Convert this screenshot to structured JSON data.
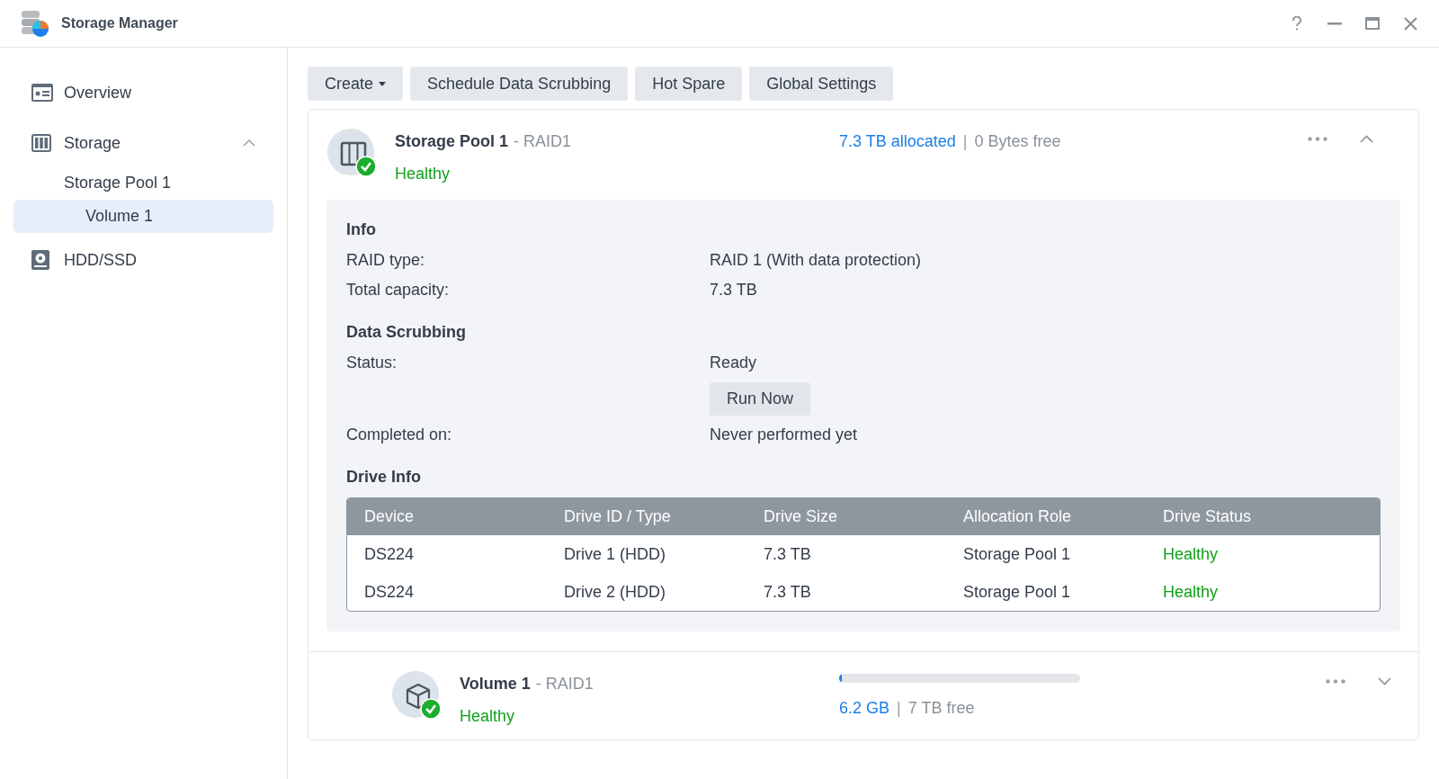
{
  "window": {
    "title": "Storage Manager"
  },
  "sidebar": {
    "items": [
      {
        "kind": "overview",
        "label": "Overview",
        "selected": false
      },
      {
        "kind": "storage",
        "label": "Storage",
        "selected": false,
        "expanded": true,
        "children": [
          {
            "label": "Storage Pool 1",
            "selected": false,
            "children": [
              {
                "label": "Volume 1",
                "selected": true
              }
            ]
          }
        ]
      },
      {
        "kind": "hdd",
        "label": "HDD/SSD",
        "selected": false
      }
    ]
  },
  "toolbar": [
    {
      "label": "Create",
      "dropdown": true
    },
    {
      "label": "Schedule Data Scrubbing",
      "dropdown": false
    },
    {
      "label": "Hot Spare",
      "dropdown": false
    },
    {
      "label": "Global Settings",
      "dropdown": false
    }
  ],
  "pool": {
    "name": "Storage Pool 1",
    "raid": "- RAID1",
    "status": "Healthy",
    "allocated": "7.3 TB allocated",
    "separator": "|",
    "free": "0 Bytes free",
    "expanded": true,
    "sections": [
      {
        "title": "Info",
        "rows": [
          {
            "label": "RAID type:",
            "value": "RAID 1 (With data protection)"
          },
          {
            "label": "Total capacity:",
            "value": "7.3 TB"
          }
        ]
      },
      {
        "title": "Data Scrubbing",
        "rows": [
          {
            "label": "Status:",
            "value": "Ready",
            "button": "Run Now"
          },
          {
            "label": "Completed on:",
            "value": "Never performed yet"
          }
        ]
      }
    ],
    "drive_info": {
      "title": "Drive Info",
      "columns": [
        "Device",
        "Drive ID / Type",
        "Drive Size",
        "Allocation Role",
        "Drive Status"
      ],
      "rows": [
        [
          "DS224",
          "Drive 1 (HDD)",
          "7.3 TB",
          "Storage Pool 1",
          "Healthy"
        ],
        [
          "DS224",
          "Drive 2 (HDD)",
          "7.3 TB",
          "Storage Pool 1",
          "Healthy"
        ]
      ]
    }
  },
  "volume": {
    "name": "Volume 1",
    "raid": "- RAID1",
    "status": "Healthy",
    "level": 0.01,
    "used": "6.2 GB",
    "separator": "|",
    "free": "7 TB free",
    "expanded": false
  }
}
